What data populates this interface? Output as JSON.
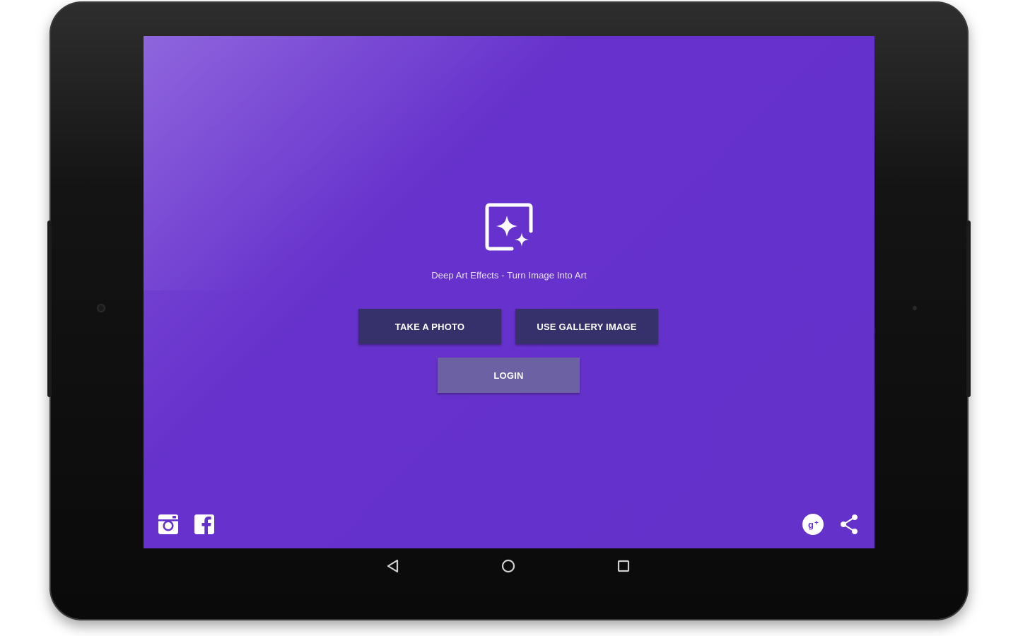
{
  "app": {
    "title": "Deep Art Effects - Turn Image Into Art",
    "logo_icon": "image-sparkle-icon"
  },
  "actions": {
    "take_photo_label": "TAKE A PHOTO",
    "gallery_label": "USE GALLERY IMAGE",
    "login_label": "LOGIN"
  },
  "social": {
    "left": [
      "instagram-icon",
      "facebook-icon"
    ],
    "right": [
      "google-plus-icon",
      "share-icon"
    ]
  },
  "system_nav": [
    "back-icon",
    "home-icon",
    "recents-icon"
  ],
  "colors": {
    "screen_bg": "#6431cb",
    "screen_highlight": "#8456da",
    "button_dark": "#36306b",
    "button_login": "#6b61a3",
    "device_frame": "#0a0a0a"
  }
}
